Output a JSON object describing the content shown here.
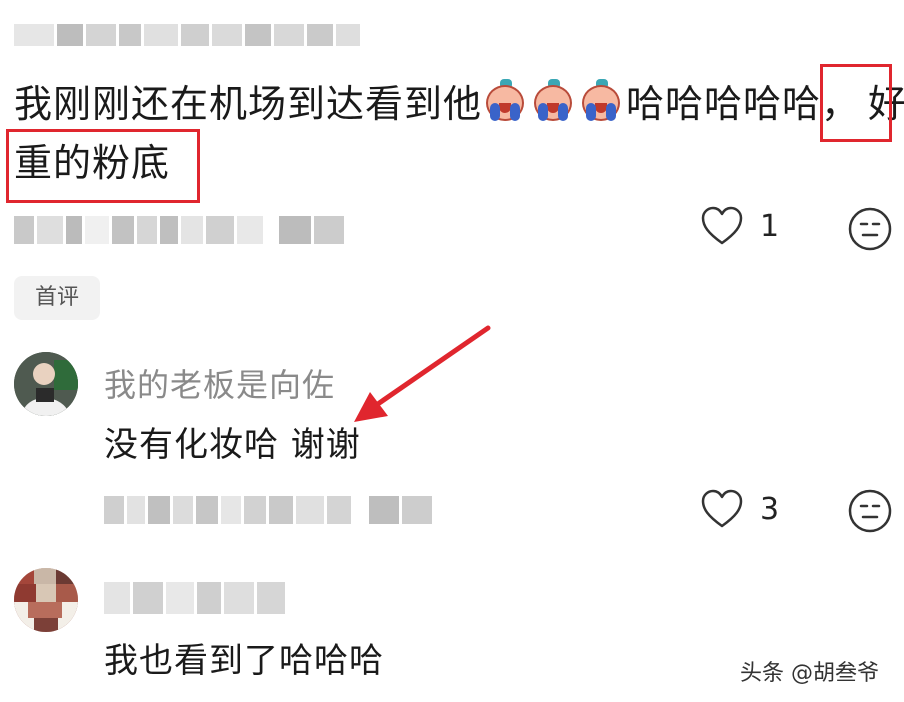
{
  "comments": [
    {
      "text_part1": "我刚刚还在机场到达看到他",
      "emoji_count": 3,
      "text_part2": "哈哈哈哈哈，",
      "highlight_a": "好",
      "highlight_b": "重的粉底",
      "likes": "1"
    },
    {
      "badge": "首评",
      "username": "我的老板是向佐",
      "text": "没有化妆哈 谢谢",
      "likes": "3"
    },
    {
      "text": "我也看到了哈哈哈"
    }
  ],
  "watermark": "头条 @胡叁爷",
  "colors": {
    "highlight": "#e0262e",
    "arrow": "#e0262e",
    "secondary_text": "#8a8a8a",
    "tag_bg": "#f2f2f2"
  },
  "icons": {
    "like": "heart-outline-icon",
    "reaction": "smiley-face-icon",
    "emoji": "crying-laughing-emoji-icon"
  }
}
